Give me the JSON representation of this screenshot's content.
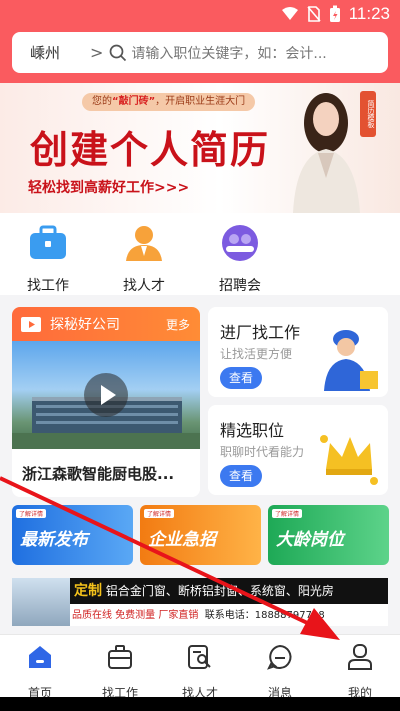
{
  "status_bar": {
    "time": "11:23"
  },
  "header": {
    "city": "嵊州",
    "city_arrow": ">",
    "search_placeholder": "请输入职位关键字，如：会计..."
  },
  "banner": {
    "pill_prefix": "您的",
    "pill_highlight": "“敲门砖”",
    "pill_suffix": "，开启职业生涯大门",
    "headline": "创建个人简历",
    "subline": "轻松找到高薪好工作>>>",
    "stamp": "简历模板"
  },
  "quick_links": [
    {
      "label": "找工作",
      "icon": "briefcase-icon"
    },
    {
      "label": "找人才",
      "icon": "person-icon"
    },
    {
      "label": "招聘会",
      "icon": "group-icon"
    }
  ],
  "company_card": {
    "title": "探秘好公司",
    "more": "更多",
    "company_name": "浙江森歌智能厨电股..."
  },
  "feature_cards": [
    {
      "title": "进厂找工作",
      "subtitle": "让找活更方便",
      "button": "查看",
      "icon": "worker-icon"
    },
    {
      "title": "精选职位",
      "subtitle": "职聊时代看能力",
      "button": "查看",
      "icon": "crown-icon"
    }
  ],
  "promos": [
    {
      "label": "最新发布",
      "tag": "了解详情",
      "color": "#2e7fe6"
    },
    {
      "label": "企业急招",
      "tag": "了解详情",
      "color": "#f07a1c"
    },
    {
      "label": "大龄岗位",
      "tag": "了解详情",
      "color": "#27b35e"
    }
  ],
  "ad": {
    "highlight": "定制",
    "line1": "铝合金门窗、断桥铝封窗、系统窗、阳光房",
    "line2_red": "品质在线  免费测量  厂家直销",
    "line2_black": "联系电话：18888797798"
  },
  "tabbar": [
    {
      "label": "首页",
      "icon": "home-icon",
      "active": true
    },
    {
      "label": "找工作",
      "icon": "briefcase-icon",
      "active": false
    },
    {
      "label": "找人才",
      "icon": "search-doc-icon",
      "active": false
    },
    {
      "label": "消息",
      "icon": "message-icon",
      "active": false
    },
    {
      "label": "我的",
      "icon": "profile-icon",
      "active": false
    }
  ],
  "colors": {
    "brand_red": "#fa5b5f",
    "accent_blue": "#3c79f0",
    "annotation_arrow": "#e8141a"
  }
}
